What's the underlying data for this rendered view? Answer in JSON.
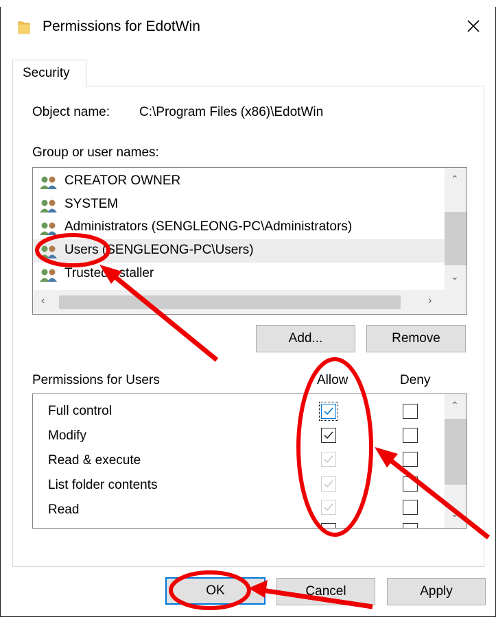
{
  "window": {
    "title": "Permissions for EdotWin",
    "close_icon": "close-icon",
    "folder_icon": "folder-icon"
  },
  "tabs": [
    {
      "label": "Security"
    }
  ],
  "object": {
    "label": "Object name:",
    "value": "C:\\Program Files (x86)\\EdotWin"
  },
  "groups": {
    "label": "Group or user names:",
    "items": [
      {
        "name": "CREATOR OWNER",
        "icon": "users-icon"
      },
      {
        "name": "SYSTEM",
        "icon": "users-icon"
      },
      {
        "name": "Administrators (SENGLEONG-PC\\Administrators)",
        "icon": "users-icon"
      },
      {
        "name": "Users (SENGLEONG-PC\\Users)",
        "icon": "users-icon",
        "selected": true
      },
      {
        "name": "TrustedInstaller",
        "icon": "users-icon"
      }
    ]
  },
  "buttons": {
    "add": "Add...",
    "remove": "Remove",
    "ok": "OK",
    "cancel": "Cancel",
    "apply": "Apply"
  },
  "permissions": {
    "label": "Permissions for Users",
    "allow_header": "Allow",
    "deny_header": "Deny",
    "items": [
      {
        "name": "Full control",
        "allow": true,
        "allow_enabled": true,
        "deny": false
      },
      {
        "name": "Modify",
        "allow": true,
        "allow_enabled": true,
        "deny": false
      },
      {
        "name": "Read & execute",
        "allow": true,
        "allow_enabled": false,
        "deny": false
      },
      {
        "name": "List folder contents",
        "allow": true,
        "allow_enabled": false,
        "deny": false
      },
      {
        "name": "Read",
        "allow": true,
        "allow_enabled": false,
        "deny": false
      }
    ]
  },
  "colors": {
    "annotation": "#ee0000",
    "focus_blue": "#0078d7",
    "selection": "#ececec"
  }
}
